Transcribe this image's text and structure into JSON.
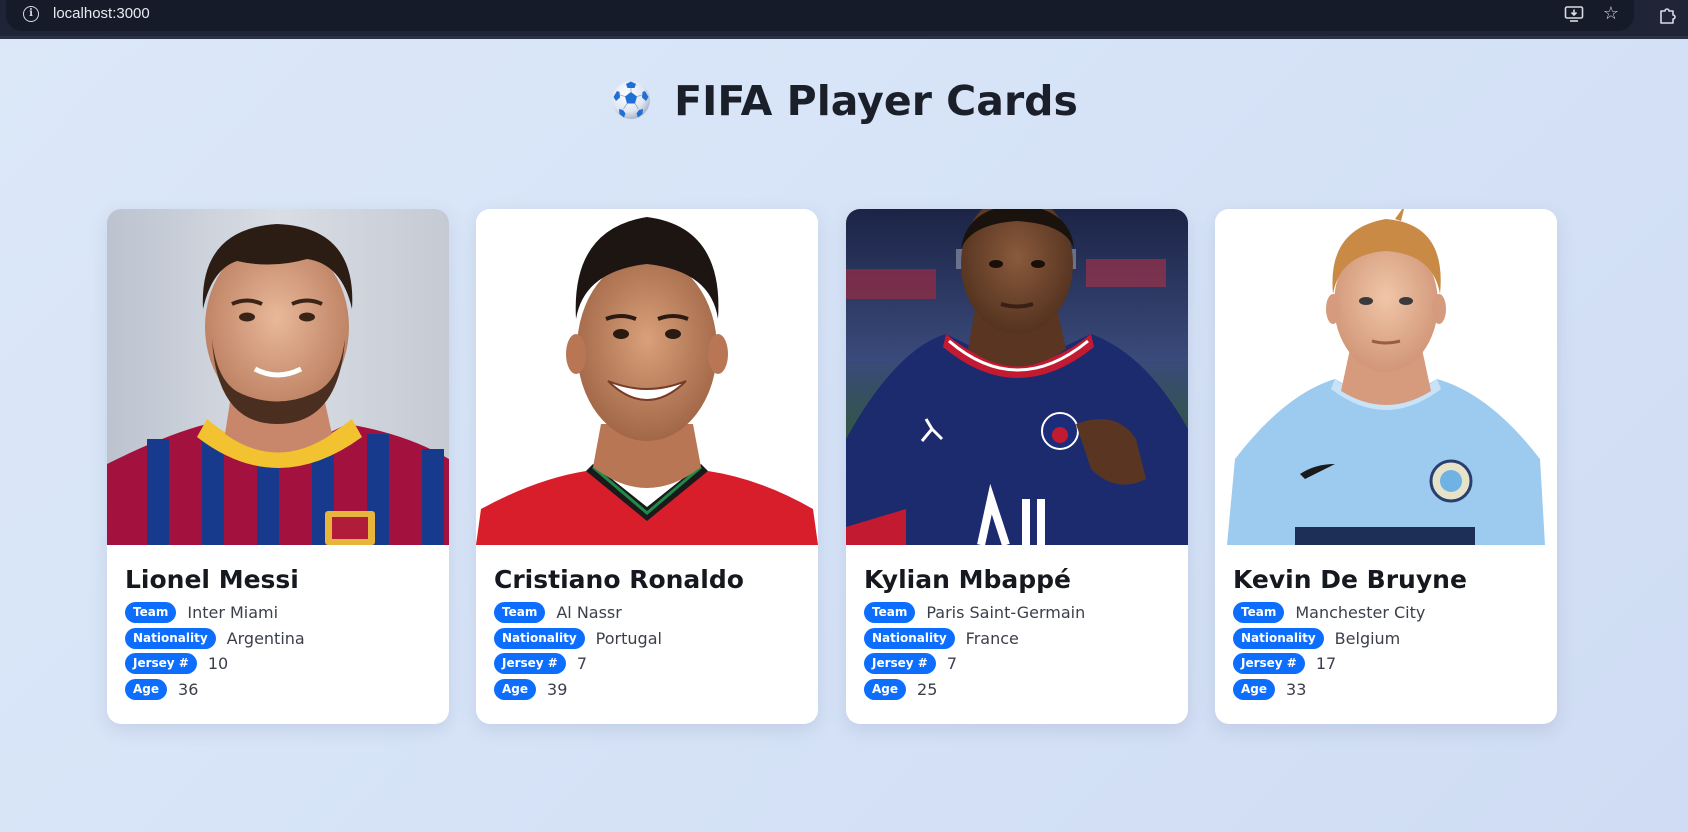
{
  "browser": {
    "url": "localhost:3000"
  },
  "page": {
    "title": "FIFA Player Cards",
    "title_icon": "soccer-ball-icon"
  },
  "labels": {
    "team": "Team",
    "nationality": "Nationality",
    "jersey": "Jersey #",
    "age": "Age"
  },
  "players": [
    {
      "name": "Lionel Messi",
      "team": "Inter Miami",
      "nationality": "Argentina",
      "jersey": "10",
      "age": "36"
    },
    {
      "name": "Cristiano Ronaldo",
      "team": "Al Nassr",
      "nationality": "Portugal",
      "jersey": "7",
      "age": "39"
    },
    {
      "name": "Kylian Mbappé",
      "team": "Paris Saint-Germain",
      "nationality": "France",
      "jersey": "7",
      "age": "25"
    },
    {
      "name": "Kevin De Bruyne",
      "team": "Manchester City",
      "nationality": "Belgium",
      "jersey": "17",
      "age": "33"
    }
  ],
  "colors": {
    "badge": "#0d6efd",
    "background": "#d6e3f7"
  }
}
